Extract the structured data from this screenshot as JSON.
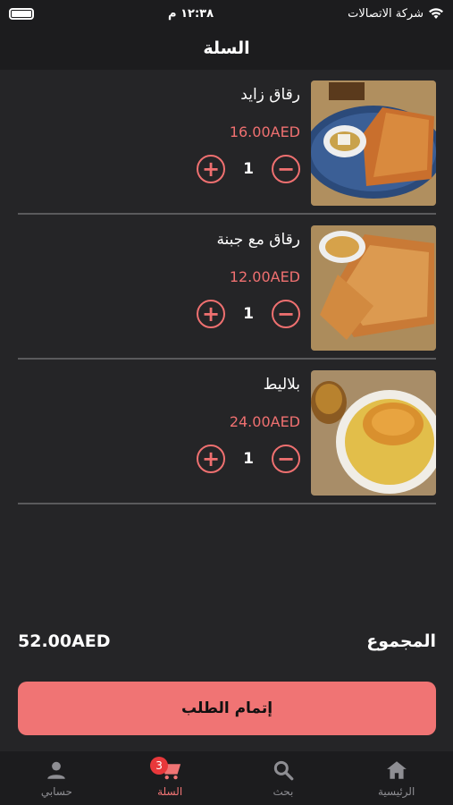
{
  "status": {
    "time": "١٢:٣٨ م",
    "carrier": "شركة الاتصالات"
  },
  "header": {
    "title": "السلة"
  },
  "items": [
    {
      "name": "رقاق زايد",
      "price": "16.00AED",
      "qty": "1"
    },
    {
      "name": "رقاق مع جبنة",
      "price": "12.00AED",
      "qty": "1"
    },
    {
      "name": "بلاليط",
      "price": "24.00AED",
      "qty": "1"
    }
  ],
  "summary": {
    "total_label": "المجموع",
    "total_amount": "52.00AED"
  },
  "checkout": {
    "label": "إتمام الطلب"
  },
  "tabs": [
    {
      "label": "حسابي",
      "icon": "person-icon"
    },
    {
      "label": "السلة",
      "icon": "cart-icon",
      "badge": "3",
      "active": true
    },
    {
      "label": "بحث",
      "icon": "search-icon"
    },
    {
      "label": "الرئيسية",
      "icon": "home-icon"
    }
  ],
  "colors": {
    "accent": "#f07474",
    "background": "#252527",
    "bar": "#1c1c1e"
  }
}
